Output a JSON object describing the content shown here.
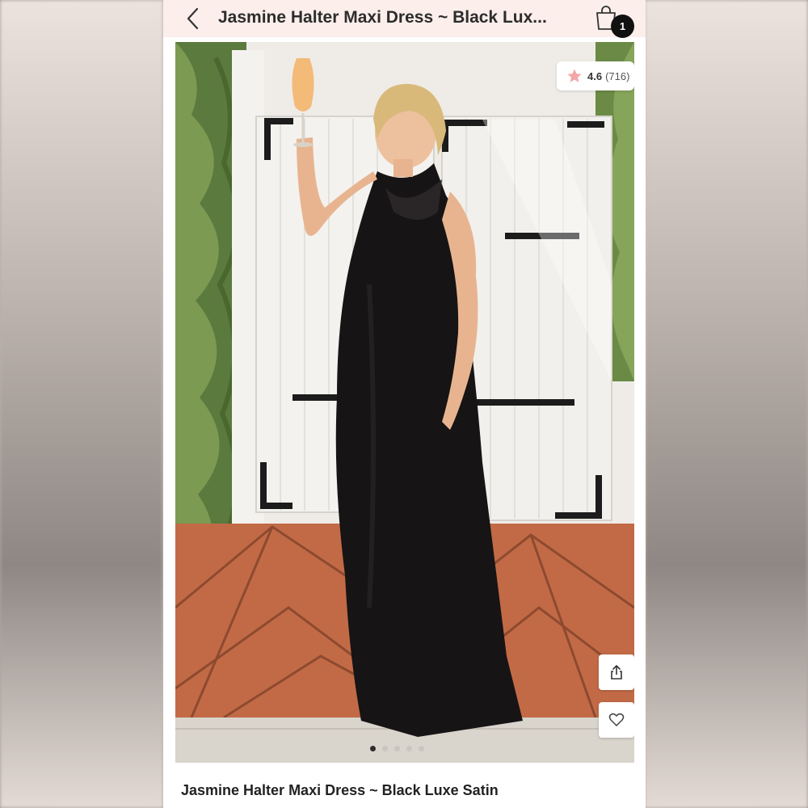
{
  "header": {
    "title": "Jasmine Halter Maxi Dress ~ Black Lux...",
    "cart_count": "1"
  },
  "rating": {
    "value": "4.6",
    "count": "(716)"
  },
  "gallery": {
    "total_images": 5,
    "active_index": 0
  },
  "product": {
    "name": "Jasmine Halter Maxi Dress ~ Black Luxe Satin"
  },
  "icons": {
    "back": "chevron-left-icon",
    "bag": "shopping-bag-icon",
    "star": "star-icon",
    "share": "share-icon",
    "wishlist": "heart-icon"
  },
  "colors": {
    "header_bg": "#fbeeeb",
    "star": "#f4a6a6",
    "badge": "#111111",
    "dot_active": "#2d2d2d",
    "dot_inactive": "#c9c6c2"
  }
}
